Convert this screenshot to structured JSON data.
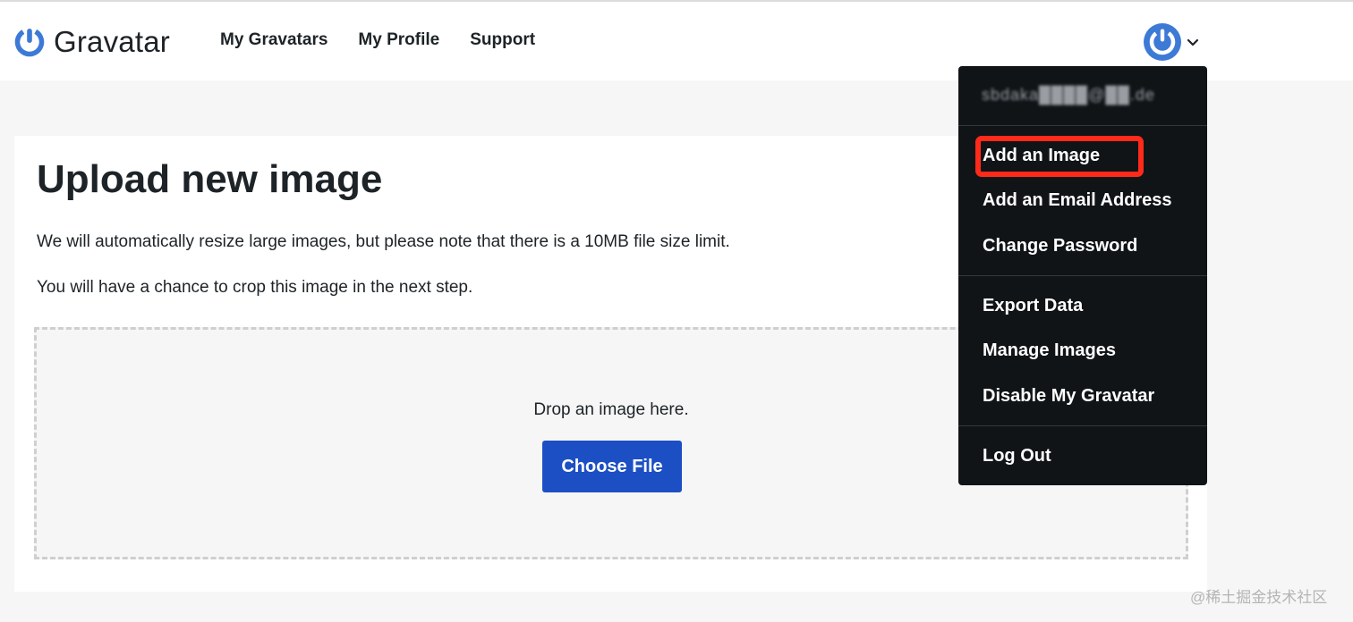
{
  "header": {
    "logo_text": "Gravatar",
    "nav": [
      "My Gravatars",
      "My Profile",
      "Support"
    ],
    "brand_color": "#3d7ad6"
  },
  "main": {
    "title": "Upload new image",
    "note_size": "We will automatically resize large images, but please note that there is a 10MB file size limit.",
    "note_crop": "You will have a chance to crop this image in the next step.",
    "drop_text": "Drop an image here.",
    "choose_button": "Choose File",
    "button_color": "#1d4fc4"
  },
  "user_menu": {
    "email": "sbdaka████@██.de",
    "items": {
      "add_image": "Add an Image",
      "add_email": "Add an Email Address",
      "change_password": "Change Password",
      "export_data": "Export Data",
      "manage_images": "Manage Images",
      "disable": "Disable My Gravatar",
      "logout": "Log Out"
    },
    "highlight_color": "#ff2a1a"
  },
  "watermark": "@稀土掘金技术社区"
}
